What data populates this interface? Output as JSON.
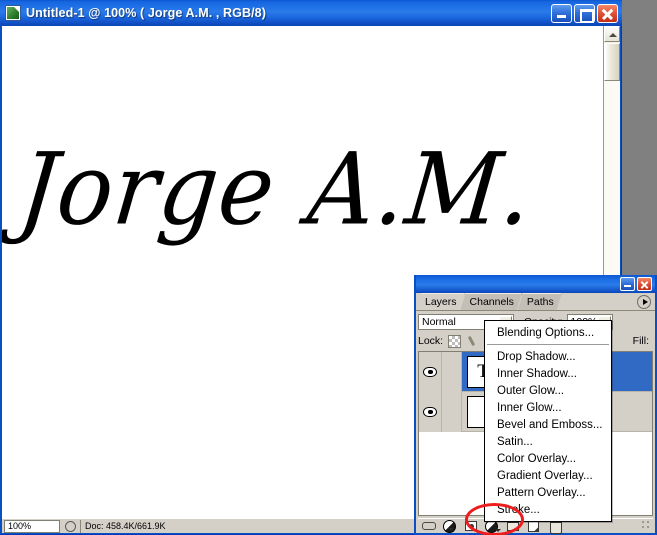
{
  "document_window": {
    "title": "Untitled-1 @ 100% ( Jorge  A.M. , RGB/8)",
    "icon": "photoshop-document-icon",
    "controls": {
      "minimize": "Minimize",
      "maximize": "Maximize",
      "close": "Close"
    },
    "canvas": {
      "text_line1": "Jorge",
      "text_line2": "A.M.",
      "background": "#ffffff"
    },
    "status": {
      "zoom": "100%",
      "doc_info": "Doc: 458.4K/661.9K"
    }
  },
  "palette": {
    "controls": {
      "minimize": "Minimize",
      "close": "Close"
    },
    "tabs": [
      {
        "label": "Layers",
        "active": true
      },
      {
        "label": "Channels",
        "active": false
      },
      {
        "label": "Paths",
        "active": false
      }
    ],
    "menu_button": "palette-menu-icon",
    "blend_mode": {
      "value": "Normal"
    },
    "opacity": {
      "label": "Opacity:",
      "value": "100%"
    },
    "lock": {
      "label": "Lock:",
      "fill_label": "Fill:"
    },
    "layers": [
      {
        "name": "",
        "thumb": "T",
        "visible": true,
        "selected": true,
        "type": "text"
      },
      {
        "name": "",
        "thumb": "",
        "visible": true,
        "selected": false,
        "type": "background"
      }
    ],
    "bottom_buttons": [
      {
        "name": "link-layers-icon"
      },
      {
        "name": "add-layer-style-icon"
      },
      {
        "name": "add-layer-mask-icon"
      },
      {
        "name": "new-adjustment-layer-icon"
      },
      {
        "name": "new-group-icon"
      },
      {
        "name": "new-layer-icon"
      },
      {
        "name": "delete-layer-icon"
      }
    ]
  },
  "context_menu": {
    "items": [
      "Blending Options...",
      "Drop Shadow...",
      "Inner Shadow...",
      "Outer Glow...",
      "Inner Glow...",
      "Bevel and Emboss...",
      "Satin...",
      "Color Overlay...",
      "Gradient Overlay...",
      "Pattern Overlay...",
      "Stroke..."
    ]
  },
  "annotation": {
    "type": "red-ellipse-highlight",
    "target": "add-layer-style-icon",
    "color": "#ee1c1c"
  },
  "colors": {
    "titlebar_blue": "#0a4fc4",
    "palette_gray": "#d4d0c8",
    "selection_blue": "#316ac5",
    "desktop_gray": "#808080"
  }
}
